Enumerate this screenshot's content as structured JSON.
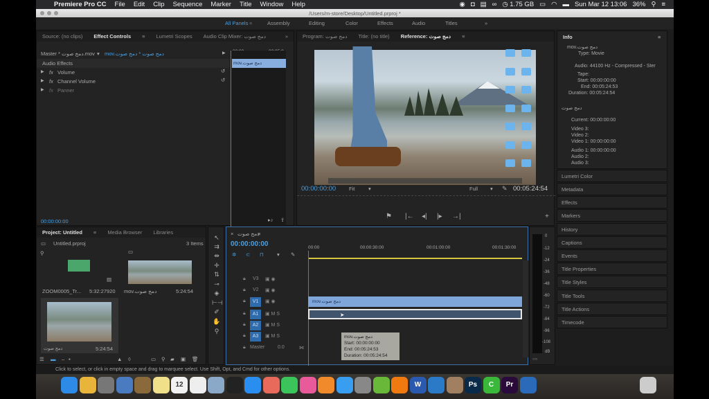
{
  "menubar": {
    "app": "Premiere Pro CC",
    "items": [
      "File",
      "Edit",
      "Clip",
      "Sequence",
      "Marker",
      "Title",
      "Window",
      "Help"
    ],
    "memory": "1.75 GB",
    "datetime": "Sun Mar 12  13:06",
    "battery": "36%"
  },
  "window": {
    "path": "/Users/m-store/Desktop/Untitled.prproj *"
  },
  "workspaces": {
    "items": [
      "All Panels",
      "Assembly",
      "Editing",
      "Color",
      "Effects",
      "Audio",
      "Titles"
    ],
    "active": "All Panels",
    "more": "»"
  },
  "source_panel": {
    "tabs": [
      "Source: (no clips)",
      "Effect Controls",
      "Lumetri Scopes",
      "Audio Clip Mixer: دمج صوت"
    ],
    "active_tab": "Effect Controls",
    "master": "Master * دمج صوت.mov",
    "clip_select": "mov.دمج صوت * دمج صوت",
    "section": "Audio Effects",
    "effects": [
      {
        "label": "Volume"
      },
      {
        "label": "Channel Volume"
      },
      {
        "label": "Panner"
      }
    ],
    "ruler_start": "00:00",
    "ruler_end": "00:05:0",
    "clip_name": "mov.دمج صوت",
    "timecode": "00:00:00:00"
  },
  "program_panel": {
    "tabs": [
      "Program: دمج صوت",
      "Title: (no title)",
      "Reference: دمج صوت"
    ],
    "active_tab": "Reference: دمج صوت",
    "timecode_current": "00:00:00:00",
    "zoom": "Fit",
    "resolution": "Full",
    "timecode_duration": "00:05:24:54"
  },
  "info_panel": {
    "title": "Info",
    "clip": "mov.دمج صوت",
    "type": "Type: Movie",
    "audio": "Audio: 44100 Hz - Compressed - Ster",
    "tape": "Tape:",
    "start": "Start: 00:00:00:00",
    "end": "End: 00:05:24:53",
    "duration": "Duration: 00:05:24:54",
    "sequence": "دمج صوت",
    "current": "Current: 00:00:00:00",
    "video3": "Video 3:",
    "video2": "Video 2:",
    "video1": "Video 1: 00:00:00:00",
    "audio1": "Audio 1: 00:00:00:00",
    "audio2": "Audio 2:",
    "audio3": "Audio 3:"
  },
  "right_panels": [
    "Lumetri Color",
    "Metadata",
    "Effects",
    "Markers",
    "History",
    "Captions",
    "Events",
    "Title Properties",
    "Title Styles",
    "Title Tools",
    "Title Actions",
    "Timecode"
  ],
  "project_panel": {
    "tabs": [
      "Project: Untitled",
      "Media Browser",
      "Libraries"
    ],
    "active_tab": "Project: Untitled",
    "file": "Untitled.prproj",
    "count": "3 Items",
    "items": [
      {
        "name": "ZOOM0005_Tr...",
        "duration": "5:32:27920"
      },
      {
        "name": "mov.دمج صوت",
        "duration": "5:24:54"
      },
      {
        "name": "دمج صوت",
        "duration": "5:24:54"
      }
    ]
  },
  "timeline": {
    "title": "دمج صوت",
    "timecode": "00:00:00:00",
    "ruler": [
      "00:00",
      "00:00:30:00",
      "00:01:00:00",
      "00:01:30:00"
    ],
    "tracks": [
      {
        "name": "V3"
      },
      {
        "name": "V2"
      },
      {
        "name": "V1"
      },
      {
        "name": "A1"
      },
      {
        "name": "A2"
      },
      {
        "name": "A3"
      }
    ],
    "master_label": "Master",
    "master_value": "0.0",
    "video_clip": "mov.دمج صوت",
    "tooltip": {
      "name": "mov.دمج صوت",
      "start": "Start: 00:00:00:00",
      "end": "End: 00:05:24:53",
      "duration": "Duration: 00:05:24:54"
    }
  },
  "meter": {
    "marks": [
      "0",
      "-12",
      "-24",
      "-36",
      "-48",
      "-60",
      "-72",
      "-84",
      "-96",
      "-108",
      "dB"
    ]
  },
  "status": {
    "text": "Click to select, or click in empty space and drag to marquee select. Use Shift, Opt, and Cmd for other options."
  },
  "dock": {
    "apps": [
      {
        "name": "Finder",
        "color": "#2d8ae6"
      },
      {
        "name": "Chrome",
        "color": "#e8b53a"
      },
      {
        "name": "Launchpad",
        "color": "#777"
      },
      {
        "name": "Mail",
        "color": "#4a7bc0"
      },
      {
        "name": "Notes",
        "color": "#8a6a3a"
      },
      {
        "name": "Stickies",
        "color": "#f0e08a"
      },
      {
        "name": "Calendar",
        "color": "#f2f2f2",
        "label": "12"
      },
      {
        "name": "Reminders",
        "color": "#eee"
      },
      {
        "name": "Preview",
        "color": "#8aa8c8"
      },
      {
        "name": "Clock",
        "color": "#222"
      },
      {
        "name": "App Store",
        "color": "#2a8ef0"
      },
      {
        "name": "Photos",
        "color": "#e86a5a"
      },
      {
        "name": "FaceTime",
        "color": "#3bc45a"
      },
      {
        "name": "iTunes",
        "color": "#e85a9a"
      },
      {
        "name": "iBooks",
        "color": "#f08a2a"
      },
      {
        "name": "Messages",
        "color": "#3a9ef0"
      },
      {
        "name": "System Preferences",
        "color": "#888"
      },
      {
        "name": "uTorrent",
        "color": "#6ab83a"
      },
      {
        "name": "VLC",
        "color": "#f07a10"
      },
      {
        "name": "Word",
        "color": "#2a5ab0",
        "label": "W"
      },
      {
        "name": "Dropbox",
        "color": "#2a7ac8"
      },
      {
        "name": "Camera",
        "color": "#a08060"
      },
      {
        "name": "Photoshop",
        "color": "#0a2a4a",
        "label": "Ps"
      },
      {
        "name": "Camtasia",
        "color": "#3ab83a",
        "label": "C"
      },
      {
        "name": "Premiere",
        "color": "#2a0a3a",
        "label": "Pr"
      },
      {
        "name": "Safari",
        "color": "#2a6ab8"
      }
    ]
  }
}
